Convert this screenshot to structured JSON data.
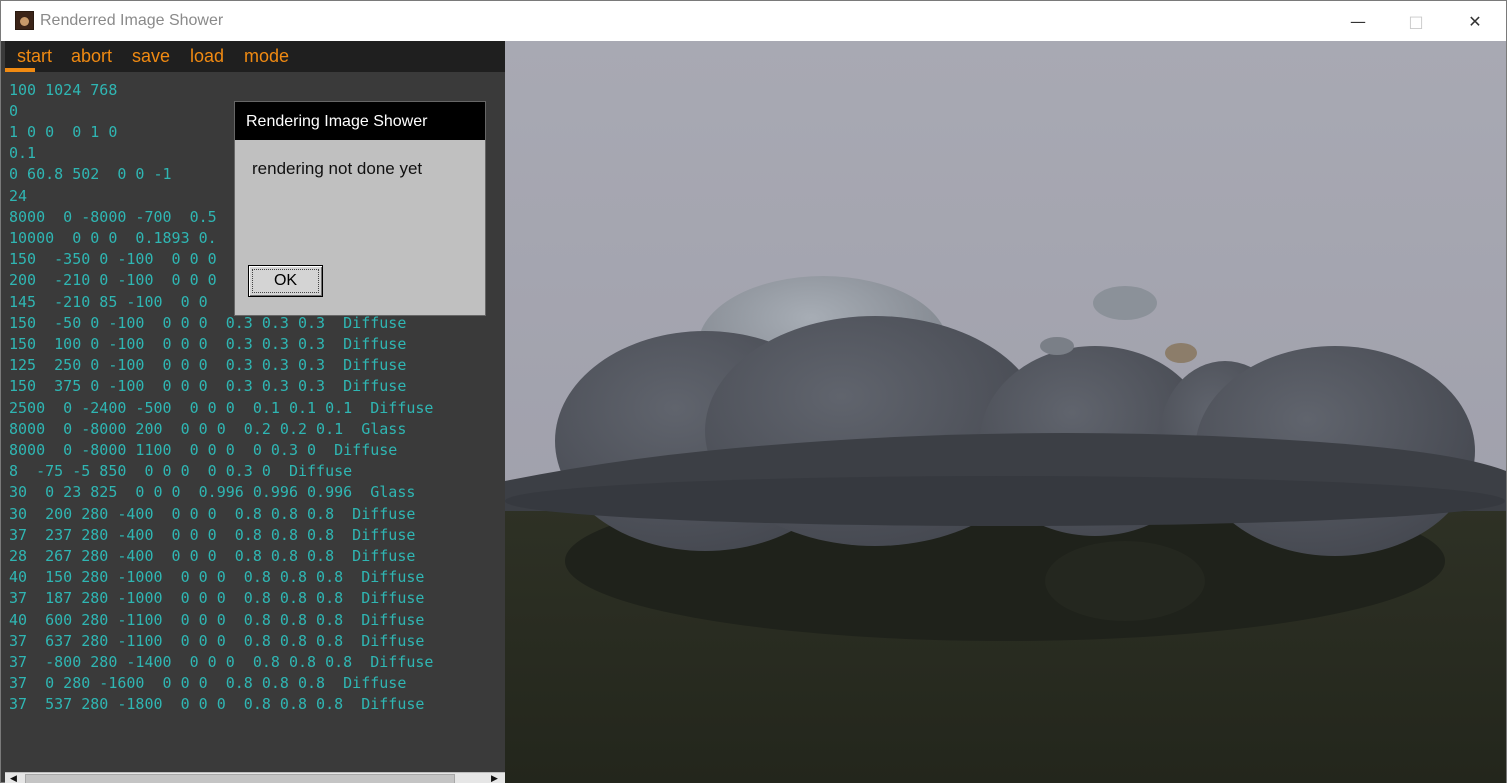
{
  "window": {
    "title": "Renderred Image Shower",
    "icons": {
      "app": "app-icon",
      "minimize": "minimize-icon",
      "maximize": "maximize-icon",
      "close": "close-icon"
    }
  },
  "menu": {
    "items": [
      {
        "label": "start"
      },
      {
        "label": "abort"
      },
      {
        "label": "save"
      },
      {
        "label": "load"
      },
      {
        "label": "mode"
      }
    ],
    "active": "start"
  },
  "editor": {
    "lines": [
      "100 1024 768",
      "0",
      "1 0 0  0 1 0",
      "0.1",
      "0 60.8 502  0 0 -1",
      "24",
      "8000  0 -8000 -700  0.5",
      "10000  0 0 0  0.1893 0.",
      "150  -350 0 -100  0 0 0",
      "200  -210 0 -100  0 0 0",
      "145  -210 85 -100  0 0",
      "150  -50 0 -100  0 0 0  0.3 0.3 0.3  Diffuse",
      "150  100 0 -100  0 0 0  0.3 0.3 0.3  Diffuse",
      "125  250 0 -100  0 0 0  0.3 0.3 0.3  Diffuse",
      "150  375 0 -100  0 0 0  0.3 0.3 0.3  Diffuse",
      "2500  0 -2400 -500  0 0 0  0.1 0.1 0.1  Diffuse",
      "8000  0 -8000 200  0 0 0  0.2 0.2 0.1  Glass",
      "8000  0 -8000 1100  0 0 0  0 0.3 0  Diffuse",
      "8  -75 -5 850  0 0 0  0 0.3 0  Diffuse",
      "30  0 23 825  0 0 0  0.996 0.996 0.996  Glass",
      "30  200 280 -400  0 0 0  0.8 0.8 0.8  Diffuse",
      "37  237 280 -400  0 0 0  0.8 0.8 0.8  Diffuse",
      "28  267 280 -400  0 0 0  0.8 0.8 0.8  Diffuse",
      "40  150 280 -1000  0 0 0  0.8 0.8 0.8  Diffuse",
      "37  187 280 -1000  0 0 0  0.8 0.8 0.8  Diffuse",
      "40  600 280 -1100  0 0 0  0.8 0.8 0.8  Diffuse",
      "37  637 280 -1100  0 0 0  0.8 0.8 0.8  Diffuse",
      "37  -800 280 -1400  0 0 0  0.8 0.8 0.8  Diffuse",
      "37  0 280 -1600  0 0 0  0.8 0.8 0.8  Diffuse",
      "37  537 280 -1800  0 0 0  0.8 0.8 0.8  Diffuse"
    ]
  },
  "dialog": {
    "title": "Rendering Image Shower",
    "message": "rendering not done yet",
    "ok_label": "OK"
  },
  "scrollbar": {
    "icons": {
      "left": "arrow-left-icon",
      "right": "arrow-right-icon"
    }
  },
  "colors": {
    "menu_accent": "#f08a12",
    "code_text": "#2fb6b3",
    "editor_bg": "#3a3a3a",
    "menu_bg": "#1f1f1f",
    "dialog_bg": "#c0c0c0",
    "dialog_title_bg": "#000000"
  }
}
